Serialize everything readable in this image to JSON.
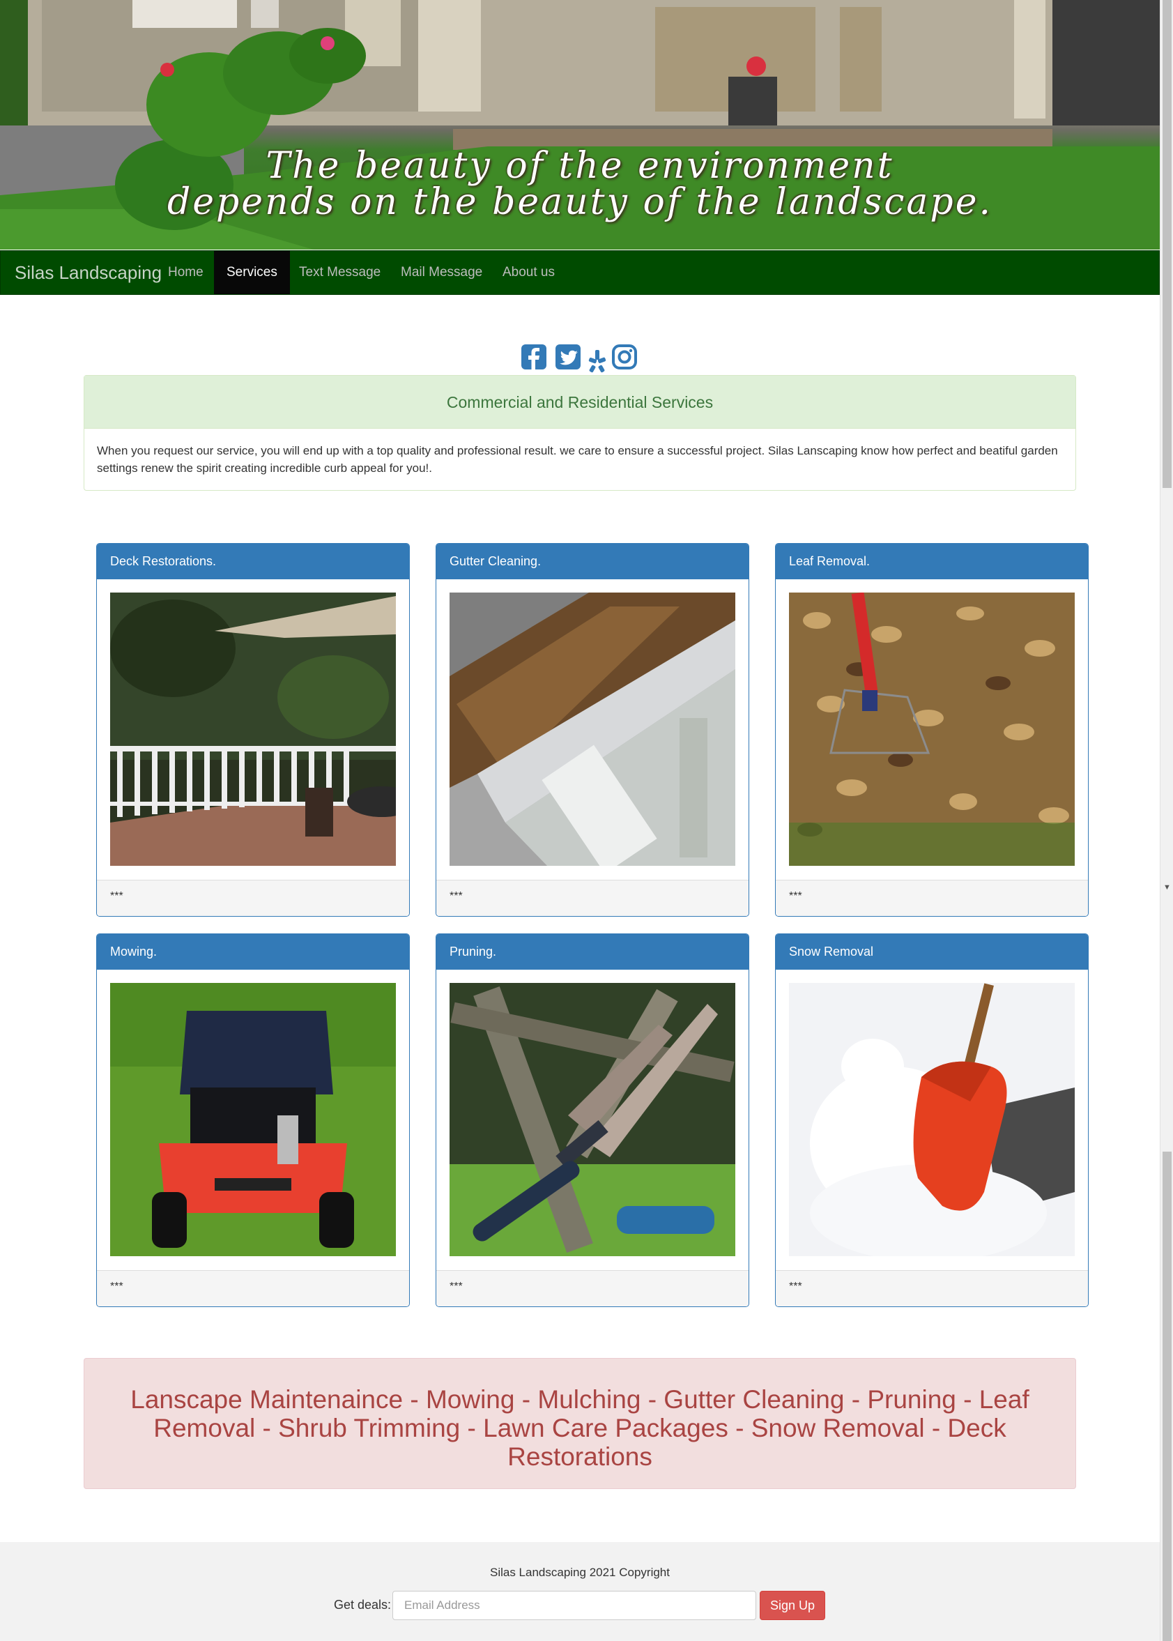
{
  "hero": {
    "quote_line1": "The beauty of the environment",
    "quote_line2": "depends on the beauty of the landscape."
  },
  "navbar": {
    "brand": "Silas Landscaping",
    "background": "#004b00",
    "items": [
      {
        "label": "Home",
        "active": false
      },
      {
        "label": "Services",
        "active": true
      },
      {
        "label": "Text Message",
        "active": false
      },
      {
        "label": "Mail Message",
        "active": false
      },
      {
        "label": "About us",
        "active": false
      }
    ]
  },
  "social": {
    "icons": [
      "facebook-icon",
      "twitter-icon",
      "yelp-icon",
      "instagram-icon"
    ],
    "color": "#337ab7"
  },
  "intro": {
    "title": "Commercial and Residential Services",
    "text": "When you request our service, you will end up with a top quality and professional result. we care to ensure a successful project. Silas Lanscaping know how perfect and beatiful garden settings renew the spirit creating incredible curb appeal for you!."
  },
  "services": [
    {
      "title": "Deck Restorations.",
      "image": "deck-photo",
      "footer": "***"
    },
    {
      "title": "Gutter Cleaning.",
      "image": "gutter-photo",
      "footer": "***"
    },
    {
      "title": "Leaf Removal.",
      "image": "leaves-photo",
      "footer": "***"
    },
    {
      "title": "Mowing.",
      "image": "mower-photo",
      "footer": "***"
    },
    {
      "title": "Pruning.",
      "image": "pruning-photo",
      "footer": "***"
    },
    {
      "title": "Snow Removal",
      "image": "snow-shovel-photo",
      "footer": "***"
    }
  ],
  "services_list": "Lanscape Maintenaince - Mowing - Mulching - Gutter Cleaning - Pruning - Leaf Removal - Shrub Trimming - Lawn Care Packages - Snow Removal - Deck Restorations",
  "footer": {
    "copyright": "Silas Landscaping 2021 Copyright",
    "deals_label": "Get deals:",
    "email_placeholder": "Email Address",
    "email_value": "",
    "signup_label": "Sign Up",
    "signup_color": "#d9534f"
  }
}
